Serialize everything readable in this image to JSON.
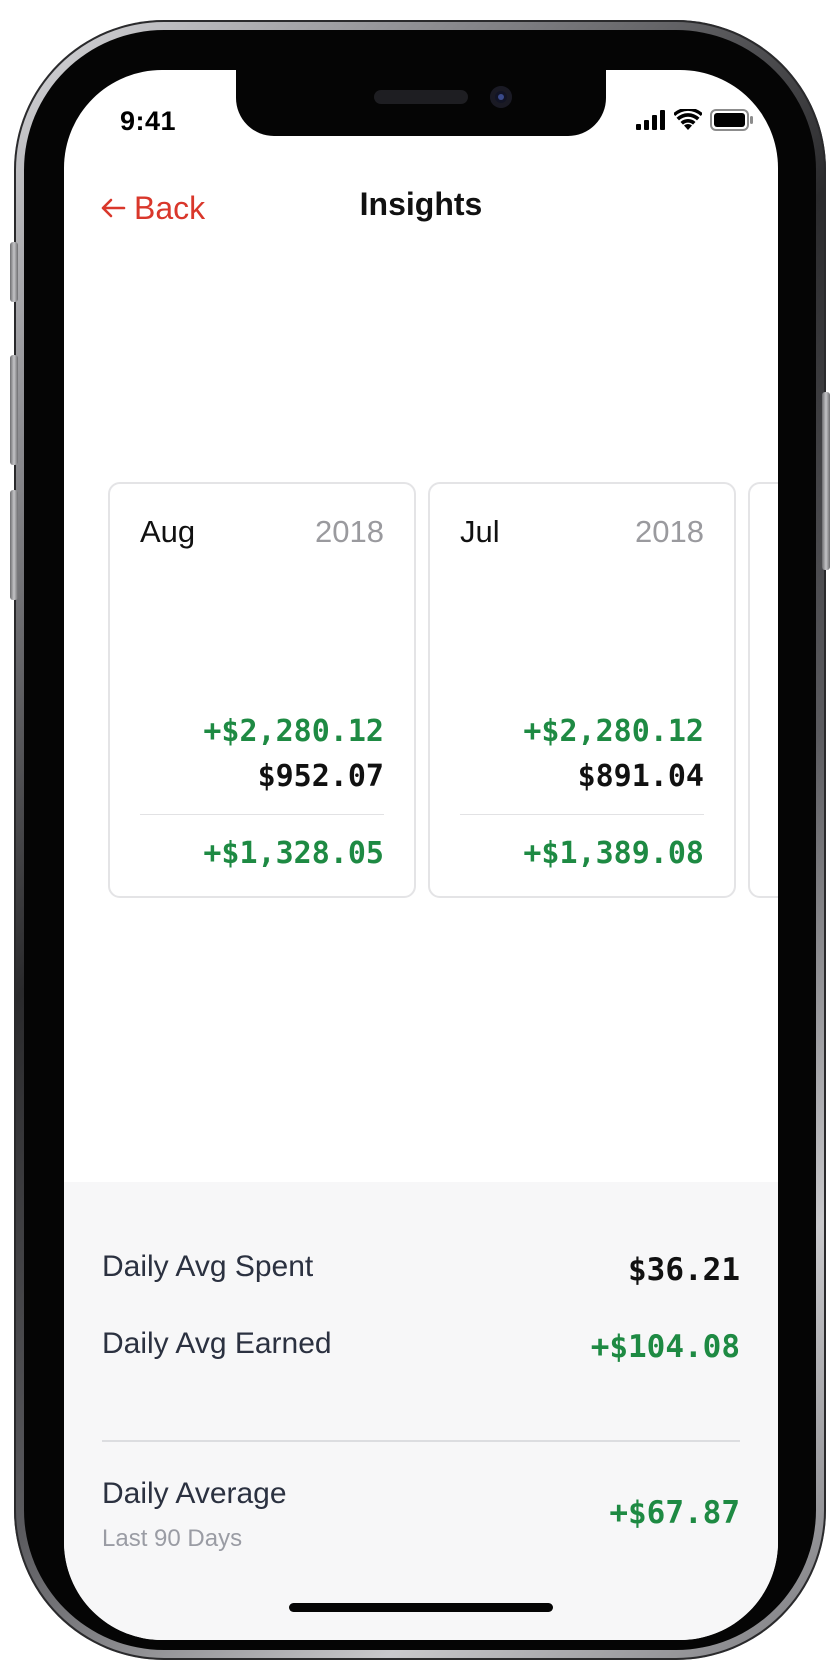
{
  "status_bar": {
    "time": "9:41",
    "icons": [
      "cellular-signal-icon",
      "wifi-icon",
      "battery-icon"
    ]
  },
  "nav": {
    "back_label": "Back",
    "title": "Insights",
    "accent_color": "#d9372b"
  },
  "months": [
    {
      "month": "Aug",
      "year": "2018",
      "earned": "+$2,280.12",
      "spent": "$952.07",
      "net": "+$1,328.05"
    },
    {
      "month": "Jul",
      "year": "2018",
      "earned": "+$2,280.12",
      "spent": "$891.04",
      "net": "+$1,389.08"
    }
  ],
  "stats": {
    "daily_avg_spent_label": "Daily Avg Spent",
    "daily_avg_spent_value": "$36.21",
    "daily_avg_earned_label": "Daily Avg Earned",
    "daily_avg_earned_value": "+$104.08",
    "daily_average_label": "Daily Average",
    "daily_average_sublabel": "Last 90 Days",
    "daily_average_value": "+$67.87"
  },
  "colors": {
    "positive": "#1e8a43",
    "neutral": "#111111",
    "muted": "#9a9a9e",
    "panel_bg": "#f7f7f8"
  }
}
